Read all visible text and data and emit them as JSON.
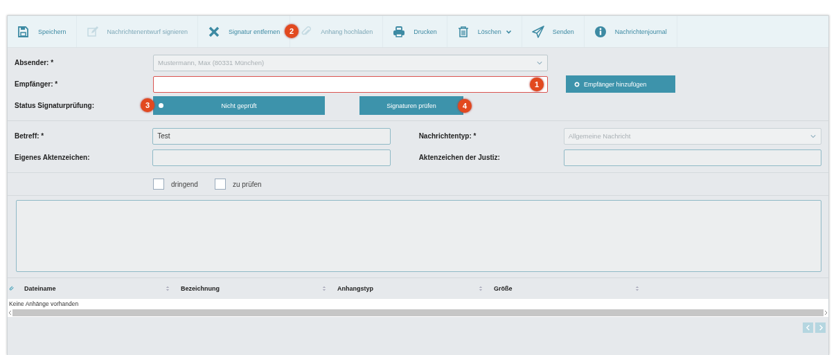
{
  "toolbar": [
    {
      "kind": "save",
      "label": "Speichern",
      "disabled": false
    },
    {
      "kind": "sign",
      "label": "Nachrichtenentwurf signieren",
      "disabled": true
    },
    {
      "kind": "remove",
      "label": "Signatur entfernen",
      "disabled": false,
      "badge": "2"
    },
    {
      "kind": "attach",
      "label": "Anhang hochladen",
      "disabled": true
    },
    {
      "kind": "print",
      "label": "Drucken",
      "disabled": false
    },
    {
      "kind": "delete",
      "label": "Löschen",
      "disabled": false,
      "dropdown": true
    },
    {
      "kind": "send",
      "label": "Senden",
      "disabled": false
    },
    {
      "kind": "info",
      "label": "Nachrichtenjournal",
      "disabled": false
    }
  ],
  "sender": {
    "label": "Absender: *",
    "value": "Mustermann, Max (80331 München)",
    "disabled": true
  },
  "recipient": {
    "label": "Empfänger: *",
    "invalid": true,
    "badge": "1",
    "add_button": "Empfänger hinzufügen"
  },
  "signature_status": {
    "label": "Status Signaturprüfung:",
    "status": "Nicht geprüft",
    "badge": "3",
    "check_button": "Signaturen prüfen",
    "check_badge": "4"
  },
  "subject": {
    "label": "Betreff: *",
    "value": "Test"
  },
  "message_type": {
    "label": "Nachrichtentyp: *",
    "placeholder": "Allgemeine Nachricht",
    "disabled": true
  },
  "own_reference": {
    "label": "Eigenes Aktenzeichen:"
  },
  "court_reference": {
    "label": "Aktenzeichen der Justiz:"
  },
  "flags": [
    {
      "label": "dringend",
      "checked": false
    },
    {
      "label": "zu prüfen",
      "checked": false
    }
  ],
  "attachments": {
    "columns": [
      "Dateiname",
      "Bezeichnung",
      "Anhangstyp",
      "Größe"
    ],
    "empty_text": "Keine Anhänge vorhanden"
  }
}
